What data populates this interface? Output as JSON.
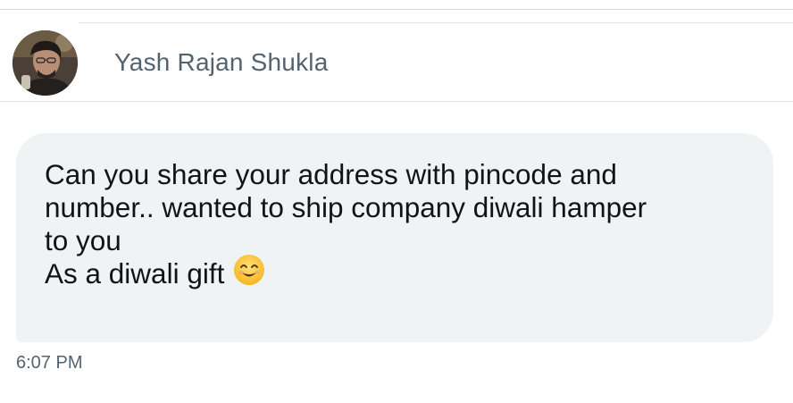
{
  "conversation": {
    "sender_name": "Yash Rajan Shukla",
    "avatar_icon": "profile-photo"
  },
  "message": {
    "lines": [
      "Can you share your address with pincode and",
      "number.. wanted to ship company diwali hamper",
      "to you",
      "As a diwali gift"
    ],
    "emoji": "smiling-face-with-smiling-eyes-icon",
    "timestamp": "6:07 PM"
  },
  "colors": {
    "bubble_background": "#eff3f4",
    "message_text": "#0f1419",
    "secondary_text": "#536471",
    "divider": "#dfe3e6"
  }
}
